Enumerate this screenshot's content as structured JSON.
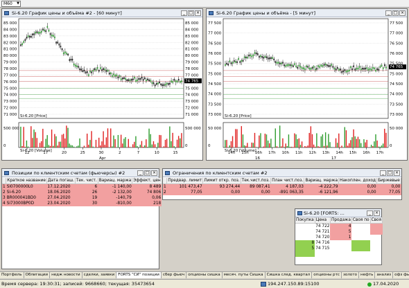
{
  "toolbar": {
    "interval": "M60"
  },
  "chart1": {
    "title": "Si-6.20 График цены и объёма #2 - [60 минут]",
    "price_label": "Si-6.20 [Price]",
    "volume_label": "Si-6.20 [Volume]",
    "y_ticks": [
      "85 000",
      "84 000",
      "83 000",
      "82 000",
      "81 000",
      "80 000",
      "79 000",
      "78 000",
      "77 000",
      "76 000",
      "75 000",
      "74 000",
      "73 000",
      "72 000",
      "71 000"
    ],
    "vol_ticks": [
      "500 000",
      "0"
    ],
    "x_ticks": [
      "12",
      "17",
      "20",
      "25",
      "30",
      "2",
      "7",
      "10",
      "15"
    ],
    "month": "Apr",
    "last_price": "74 765"
  },
  "chart2": {
    "title": "Si-6.20 График цены и объёма - [5 минут]",
    "price_label": "Si-6.20 [Price]",
    "volume_label": "Si-6.20 [Volume]",
    "y_ticks": [
      "77 500",
      "77 000",
      "76 500",
      "76 000",
      "75 500",
      "75 000",
      "74 500",
      "74 000",
      "73 500",
      "73 000"
    ],
    "vol_ticks": [
      "50 000",
      "0"
    ],
    "x_ticks": [
      "14h",
      "15h",
      "16h",
      "17h",
      "10h",
      "11h",
      "12h",
      "13h",
      "14h",
      "15h",
      "16h",
      "17h"
    ],
    "day_marks": [
      "16",
      "17"
    ],
    "last_price": "74 765"
  },
  "positions": {
    "title": "Позиции по клиентским счетам (фьючерсы) #2",
    "columns": [
      "",
      "Краткое название",
      "Дата погаш.",
      "Тек. чист.",
      "Вариац. маржа",
      "Эффект. цен"
    ],
    "rows": [
      [
        "1",
        "Si0700000L0",
        "17.12.2020",
        "6",
        "-1 140,00",
        "8 489"
      ],
      [
        "2",
        "Si-6.20",
        "18.06.2020",
        "26",
        "-2 132,00",
        "74 806"
      ],
      [
        "3",
        "BR000041BD0",
        "27.04.2020",
        "19",
        "-140,79",
        "0,06"
      ],
      [
        "4",
        "Si73000BP0D",
        "23.04.2020",
        "30",
        "-810,00",
        "218"
      ]
    ]
  },
  "limits": {
    "title": "Ограничения по клиентским счетам #2",
    "columns": [
      "",
      "Предвар. лимит",
      "Лимит откр. поз.",
      "Тек.чист.поз.",
      "План чист.поз.",
      "Вариац. маржа",
      "Накоплен. доход",
      "Биржевые"
    ],
    "rows": [
      [
        "1",
        "101 473,47",
        "93 274,44",
        "89 087,41",
        "4 187,03",
        "-4 222,79",
        "0,00",
        "0,00"
      ],
      [
        "2",
        "77,05",
        "0,00",
        "0,00",
        "-891 063,35",
        "-6 121,96",
        "0,00",
        "77,05"
      ]
    ]
  },
  "orderbook": {
    "title": "Si-6.20 [FORTS: ...",
    "columns": [
      "Покупка",
      "Цена",
      "Продажа",
      "Своя по",
      "Своя"
    ],
    "rows": [
      [
        "",
        "74 722",
        "4",
        "",
        ""
      ],
      [
        "",
        "74 721",
        "5",
        "",
        ""
      ],
      [
        "",
        "74 720",
        "1",
        "",
        ""
      ],
      [
        "8",
        "74 716",
        "",
        "",
        ""
      ],
      [
        "5",
        "74 715",
        "",
        "",
        ""
      ],
      [
        "",
        "",
        "",
        "",
        ""
      ],
      [
        "",
        "",
        "",
        "",
        ""
      ]
    ]
  },
  "tabs": [
    "Портфель",
    "Облигации",
    "недж новости",
    "сделки, заявки",
    "FORTS \"СИ\" позиции",
    "сбер фьюч",
    "опционы сишка",
    "месяч. путы Сишка",
    "Сишка след. квартал",
    "опционы ртс",
    "золото",
    "нефть",
    "анализ",
    "офз фьючи"
  ],
  "status": {
    "server_time": "Время сервера: 19:30:31; записей: 9668660; текущая: 35473654",
    "connection": "194.247.150.89:15100",
    "date": "17.04.2020"
  },
  "colors": {
    "pink_row": "#f2a0a0",
    "bid_green": "#92d050",
    "ask_red": "#f2a0a0",
    "candle_green": "#2e9c2e",
    "volume_red": "#e02020"
  }
}
